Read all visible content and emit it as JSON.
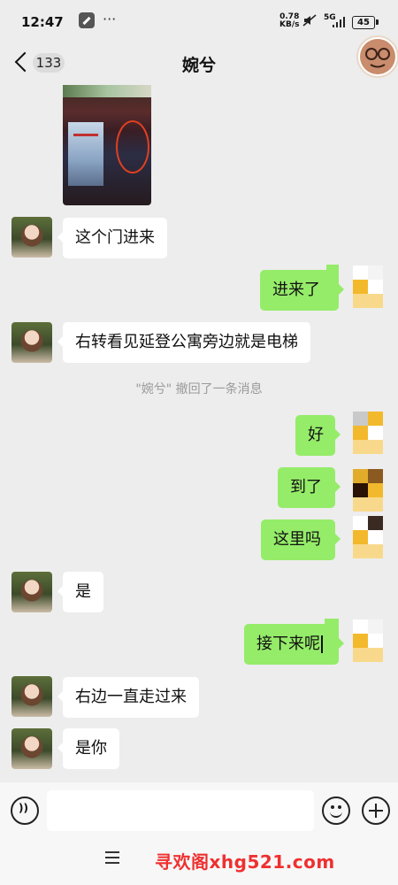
{
  "status_bar": {
    "time": "12:47",
    "more": "···",
    "net_speed_value": "0.78",
    "net_speed_unit": "KB/s",
    "signal_label": "5G",
    "battery": "45"
  },
  "header": {
    "unread_count": "133",
    "title": "婉兮"
  },
  "messages": {
    "m1": "这个门进来",
    "m2": "进来了",
    "m3": "右转看见延登公寓旁边就是电梯",
    "recall": "\"婉兮\" 撤回了一条消息",
    "m4": "好",
    "m5": "到了",
    "m6": "这里吗",
    "m7": "是",
    "m8": "接下来呢",
    "m9": "右边一直走过来",
    "m10": "是你"
  },
  "input": {
    "placeholder": ""
  },
  "footer": {
    "watermark": "寻欢阁xhg521.com"
  },
  "colors": {
    "background": "#ededed",
    "outgoing_bubble": "#95ec69",
    "incoming_bubble": "#ffffff",
    "watermark": "#ef3030"
  },
  "icons": [
    "back-chevron-icon",
    "wrench-icon",
    "mute-icon",
    "voice-icon",
    "emoji-icon",
    "plus-icon",
    "menu-icon"
  ]
}
